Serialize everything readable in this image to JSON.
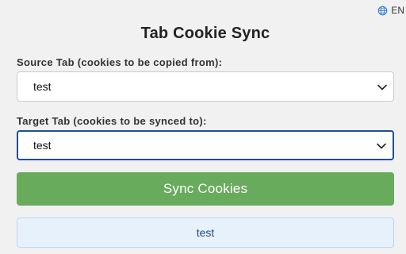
{
  "language": {
    "code": "EN",
    "icon": "globe-icon"
  },
  "title": "Tab Cookie Sync",
  "source": {
    "label": "Source Tab (cookies to be copied from):",
    "selected": "test"
  },
  "target": {
    "label": "Target Tab (cookies to be synced to):",
    "selected": "test"
  },
  "sync_button": {
    "label": "Sync Cookies",
    "color": "#69ab5d"
  },
  "status": {
    "message": "test"
  }
}
